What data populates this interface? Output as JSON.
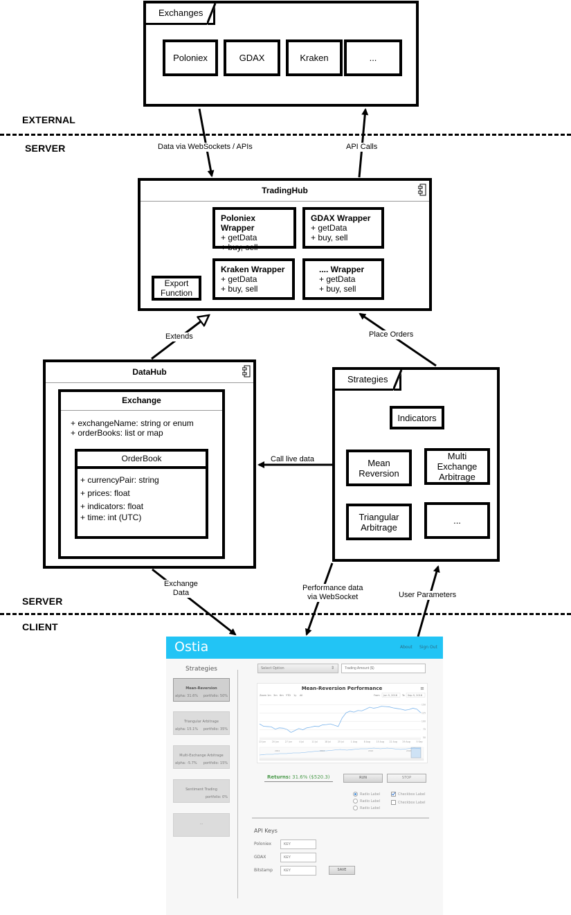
{
  "zones": {
    "external": "EXTERNAL",
    "server_top": "SERVER",
    "server_bottom": "SERVER",
    "client": "CLIENT"
  },
  "exchanges": {
    "title": "Exchanges",
    "items": [
      "Poloniex",
      "GDAX",
      "Kraken",
      "..."
    ]
  },
  "connections": {
    "data_via_websockets": "Data via WebSockets / APIs",
    "api_calls": "API Calls",
    "extends": "Extends",
    "place_orders": "Place Orders",
    "call_live_data": "Call live data",
    "exchange_data": "Exchange\nData",
    "exchange_data_line1": "Exchange",
    "exchange_data_line2": "Data",
    "performance_line1": "Performance data",
    "performance_line2": "via WebSocket",
    "user_parameters": "User Parameters"
  },
  "trading_hub": {
    "title": "TradingHub",
    "export_line1": "Export",
    "export_line2": "Function",
    "wrappers": [
      {
        "title": "Poloniex Wrapper",
        "methods": [
          "+ getData",
          "+ buy, sell"
        ]
      },
      {
        "title": "GDAX Wrapper",
        "methods": [
          "+ getData",
          "+ buy, sell"
        ]
      },
      {
        "title": "Kraken Wrapper",
        "methods": [
          "+ getData",
          "+ buy, sell"
        ]
      },
      {
        "title": ".... Wrapper",
        "methods": [
          "+ getData",
          "+ buy, sell"
        ]
      }
    ]
  },
  "data_hub": {
    "title": "DataHub",
    "exchange": {
      "title": "Exchange",
      "attributes": [
        "+ exchangeName: string or enum",
        "+ orderBooks: list or map"
      ]
    },
    "order_book": {
      "title": "OrderBook",
      "attributes": [
        "+ currencyPair: string",
        "+ prices: float",
        "+ indicators: float",
        "+ time: int (UTC)"
      ]
    }
  },
  "strategies": {
    "title": "Strategies",
    "indicators": "Indicators",
    "items": [
      {
        "line1": "Mean",
        "line2": "Reversion"
      },
      {
        "line1": "Multi Exchange",
        "line2": "Arbitrage"
      },
      {
        "line1": "Triangular",
        "line2": "Arbitrage"
      },
      {
        "line1": "...",
        "line2": ""
      }
    ]
  },
  "client_app": {
    "logo": "Ostia",
    "nav": {
      "about": "About",
      "sign_out": "Sign Out"
    },
    "colors": {
      "header": "#22c4f5",
      "returns": "#4a9a4a",
      "chart_line": "#7cb5ec"
    },
    "sidebar": {
      "title": "Strategies",
      "cards": [
        {
          "name": "Mean-Reversion",
          "alpha": "alpha: 31.6%",
          "portfolio": "portfolio: 50%",
          "active": true
        },
        {
          "name": "Triangular Arbitrage",
          "alpha": "alpha: 15.1%",
          "portfolio": "portfolio: 35%",
          "active": false
        },
        {
          "name": "Multi-Exchange Arbitrage",
          "alpha": "alpha: -5.7%",
          "portfolio": "portfolio: 15%",
          "active": false
        },
        {
          "name": "Sentiment Trading",
          "alpha": "",
          "portfolio": "portfolio: 0%",
          "active": false
        },
        {
          "name": "...",
          "alpha": "",
          "portfolio": "",
          "active": false
        }
      ]
    },
    "select": {
      "value": "Select Option",
      "arrow": "⇕"
    },
    "trading_amount": {
      "placeholder": "Trading Amount ($)"
    },
    "chart": {
      "menu_icon": "≡",
      "zoom_label": "Zoom",
      "zoom_options": [
        "1m",
        "3m",
        "6m",
        "YTD",
        "1y",
        "All"
      ],
      "from_label": "From",
      "from_value": "Jun 9, 2016",
      "to_label": "To",
      "to_value": "Sep 9, 2016",
      "navigator_labels": [
        "2004",
        "2012",
        "2016",
        "2016"
      ]
    },
    "returns": {
      "label": "Returns:",
      "value": "31.6% ($520.3)"
    },
    "buttons": {
      "run": "RUN",
      "stop": "STOP",
      "save": "SAVE"
    },
    "radios": [
      {
        "label": "Radio Label",
        "checked": true
      },
      {
        "label": "Radio Label",
        "checked": false
      },
      {
        "label": "Radio Label",
        "checked": false
      }
    ],
    "checkboxes": [
      {
        "label": "Checkbox Label",
        "checked": true
      },
      {
        "label": "Checkbox Label",
        "checked": false
      }
    ],
    "api_keys": {
      "title": "API Keys",
      "fields": [
        {
          "label": "Poloniex",
          "placeholder": "KEY"
        },
        {
          "label": "GDAX",
          "placeholder": "KEY"
        },
        {
          "label": "Bitstamp",
          "placeholder": "KEY"
        }
      ]
    }
  },
  "chart_data": {
    "type": "line",
    "title": "Mean-Reversion Performance",
    "xlabel": "",
    "ylabel": "",
    "x": [
      "13 Jun",
      "20 Jun",
      "27 Jun",
      "4 Jul",
      "11 Jul",
      "18 Jul",
      "25 Jul",
      "1 Aug",
      "8 Aug",
      "15 Aug",
      "22 Aug",
      "29 Aug",
      "5 Sep"
    ],
    "yticks": [
      50,
      75,
      100,
      125,
      150
    ],
    "ylim": [
      50,
      160
    ],
    "grid": true,
    "legend": "none",
    "series": [
      {
        "name": "Mean-Reversion",
        "values": [
          92,
          85,
          84,
          83,
          76,
          80,
          79,
          75,
          66,
          72,
          78,
          74,
          80,
          82,
          85,
          84,
          89,
          90,
          92,
          88,
          84,
          110,
          126,
          131,
          128,
          133,
          132,
          137,
          143,
          140,
          142,
          146,
          145,
          144,
          141,
          139,
          137,
          134,
          136,
          140,
          137,
          126
        ]
      }
    ]
  }
}
